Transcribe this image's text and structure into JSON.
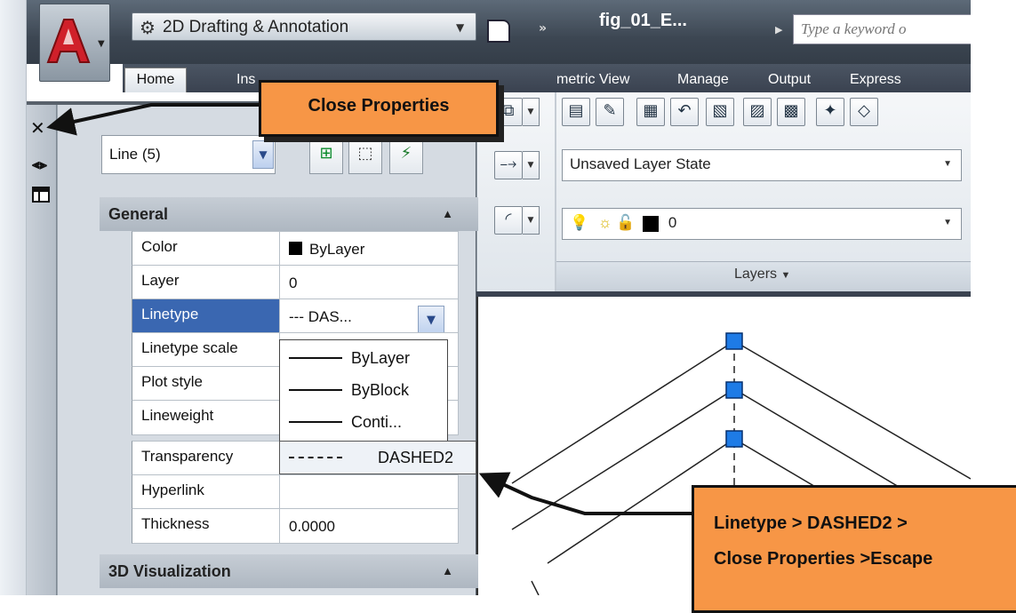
{
  "titlebar": {
    "workspace": "2D Drafting & Annotation",
    "document_title": "fig_01_E...",
    "search_placeholder": "Type a keyword o"
  },
  "tabs": [
    {
      "label": "Home"
    },
    {
      "label": "Ins"
    },
    {
      "label": "metric"
    },
    {
      "label": "View"
    },
    {
      "label": "Manage"
    },
    {
      "label": "Output"
    },
    {
      "label": "Express"
    }
  ],
  "ribbon": {
    "layer_state": "Unsaved Layer State",
    "current_layer": "0",
    "panel_label": "Layers"
  },
  "properties": {
    "selection": "Line (5)",
    "sections": {
      "general": "General",
      "visualization": "3D Visualization"
    },
    "rows": [
      {
        "label": "Color",
        "value": "ByLayer"
      },
      {
        "label": "Layer",
        "value": "0"
      },
      {
        "label": "Linetype",
        "value": "--- DAS..."
      },
      {
        "label": "Linetype scale",
        "value": ""
      },
      {
        "label": "Plot style",
        "value": ""
      },
      {
        "label": "Lineweight",
        "value": ""
      },
      {
        "label": "Transparency",
        "value": ""
      },
      {
        "label": "Hyperlink",
        "value": ""
      },
      {
        "label": "Thickness",
        "value": "0.0000"
      }
    ],
    "linetype_options": [
      "ByLayer",
      "ByBlock",
      "Conti...",
      "DASHED2"
    ]
  },
  "callouts": {
    "close": "Close Properties",
    "steps_line1": "Linetype > DASHED2 >",
    "steps_line2": "Close Properties >Escape"
  },
  "colors": {
    "callout": "#f79646",
    "selected_row": "#3a67b1",
    "grip": "#1e7be6"
  }
}
